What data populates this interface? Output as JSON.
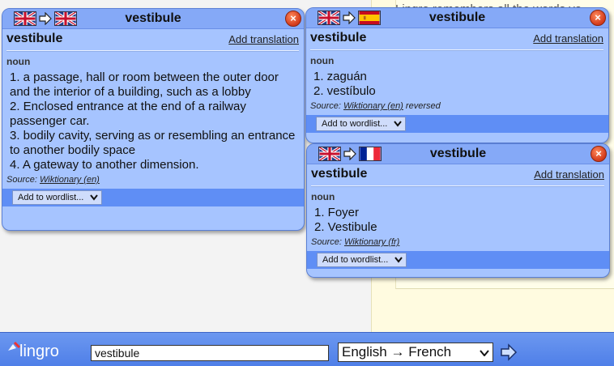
{
  "background": {
    "line1": "Lingro remembers all the words yo",
    "line2": "u"
  },
  "popups": [
    {
      "title": "vestibule",
      "flags": [
        "uk-flag",
        "uk-flag"
      ],
      "headword": "vestibule",
      "add_translation": "Add translation",
      "pos": "noun",
      "definitions": [
        "1. a passage, hall or room between the outer door and the interior of a building, such as a lobby",
        "2. Enclosed entrance at the end of a railway passenger car.",
        "3. bodily cavity, serving as or resembling an entrance to another bodily space",
        "4. A gateway to another dimension."
      ],
      "source_label": "Source:",
      "source_link": "Wiktionary (en)",
      "source_suffix": "",
      "wordlist_label": "Add to wordlist..."
    },
    {
      "title": "vestibule",
      "flags": [
        "uk-flag",
        "spain-flag"
      ],
      "headword": "vestibule",
      "add_translation": "Add translation",
      "pos": "noun",
      "definitions": [
        "1. zaguán",
        "2. vestíbulo"
      ],
      "source_label": "Source:",
      "source_link": "Wiktionary (en)",
      "source_suffix": " reversed",
      "wordlist_label": "Add to wordlist..."
    },
    {
      "title": "vestibule",
      "flags": [
        "uk-flag",
        "france-flag"
      ],
      "headword": "vestibule",
      "add_translation": "Add translation",
      "pos": "noun",
      "definitions": [
        "1. Foyer",
        "2. Vestibule"
      ],
      "source_label": "Source:",
      "source_link": "Wiktionary (fr)",
      "source_suffix": "",
      "wordlist_label": "Add to wordlist..."
    }
  ],
  "toolbar": {
    "logo_text": "lingro",
    "search_value": "vestibule",
    "language_selected": "English → French"
  },
  "colors": {
    "popup_bg": "#a6c4ff",
    "titlebar": "#85a9f7",
    "wordlist_bar": "#5f8ef5",
    "toolbar": "#5a88ec",
    "close_button": "#d2391b"
  }
}
